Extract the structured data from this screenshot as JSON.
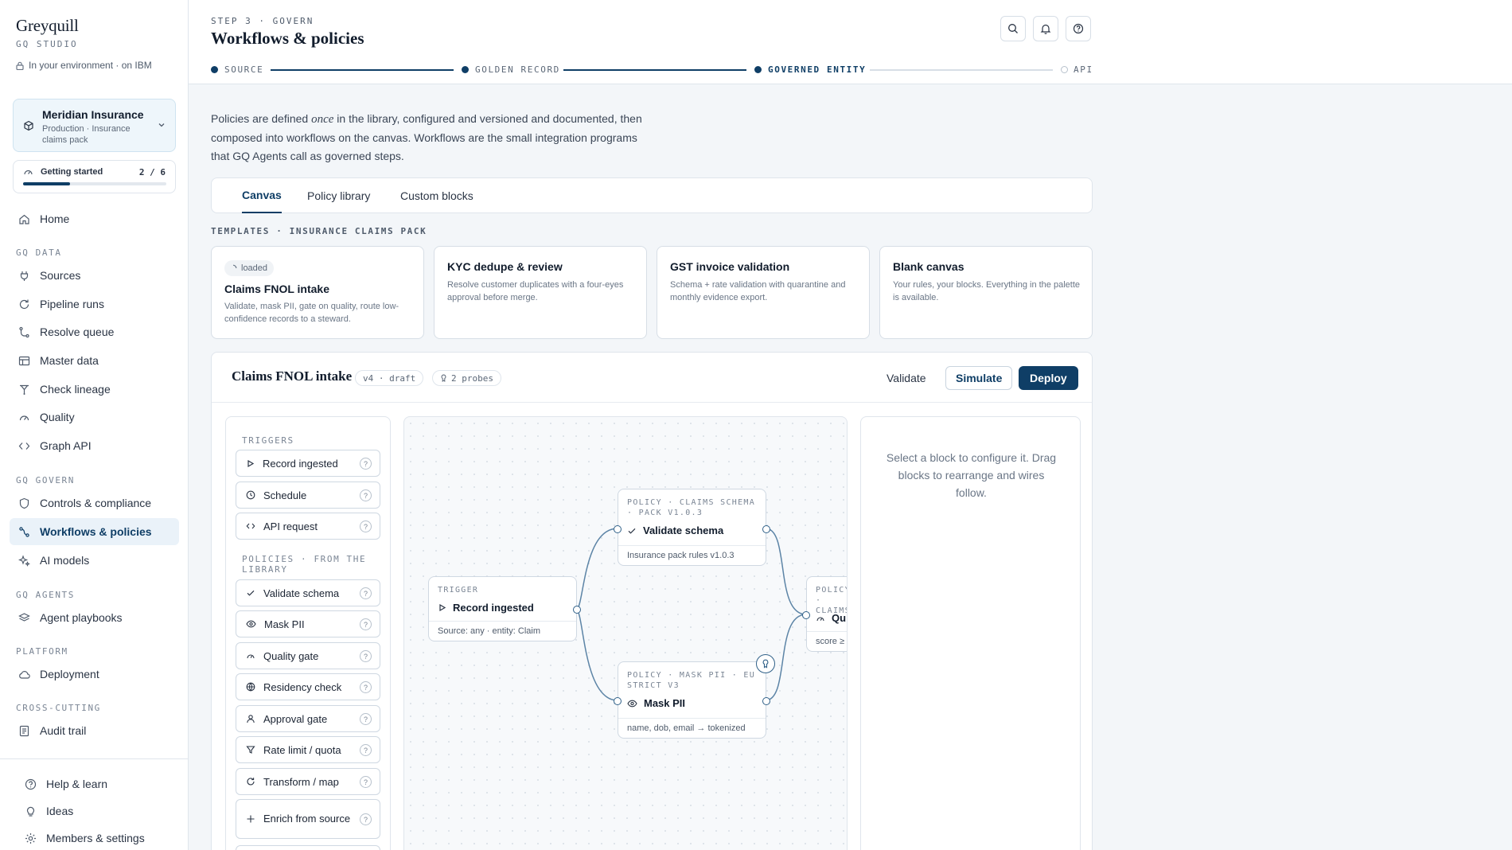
{
  "sidebar": {
    "brand": "Greyquill",
    "studio": "GQ STUDIO",
    "env": "In your environment · on IBM",
    "org": {
      "name": "Meridian Insurance",
      "sub": "Production · Insurance claims pack"
    },
    "getting_started": {
      "label": "Getting started",
      "count": "2 / 6",
      "progress": 0.33
    },
    "items": [
      {
        "label": "Home",
        "icon": "home-icon"
      },
      {
        "label": "Sources",
        "icon": "plug-icon"
      },
      {
        "label": "Pipeline runs",
        "icon": "refresh-icon"
      },
      {
        "label": "Resolve queue",
        "icon": "branch-icon"
      },
      {
        "label": "Master data",
        "icon": "table-icon"
      },
      {
        "label": "Check lineage",
        "icon": "lineage-icon"
      },
      {
        "label": "Quality",
        "icon": "gauge-icon"
      },
      {
        "label": "Graph API",
        "icon": "code-icon"
      },
      {
        "label": "Controls & compliance",
        "icon": "shield-icon"
      },
      {
        "label": "Workflows & policies",
        "icon": "workflow-icon"
      },
      {
        "label": "AI models",
        "icon": "sparkle-icon"
      },
      {
        "label": "Agent playbooks",
        "icon": "layers-icon"
      },
      {
        "label": "Deployment",
        "icon": "cloud-icon"
      },
      {
        "label": "Audit trail",
        "icon": "document-icon"
      }
    ],
    "sections": {
      "data": "GQ DATA",
      "govern": "GQ GOVERN",
      "agents": "GQ AGENTS",
      "platform": "PLATFORM",
      "cross": "CROSS-CUTTING"
    },
    "footer": [
      {
        "label": "Help & learn",
        "icon": "help-icon"
      },
      {
        "label": "Ideas",
        "icon": "bulb-icon"
      },
      {
        "label": "Members & settings",
        "icon": "gear-icon"
      }
    ]
  },
  "header": {
    "step": "STEP 3 · GOVERN",
    "title": "Workflows & policies",
    "stepper": [
      "SOURCE",
      "GOLDEN RECORD",
      "GOVERNED ENTITY",
      "API"
    ]
  },
  "intro": {
    "before": "Policies are defined ",
    "emph": "once",
    "after": " in the library, configured and versioned and documented, then composed into workflows on the canvas. Workflows are the small integration programs that GQ Agents call as governed steps."
  },
  "tabs": [
    "Canvas",
    "Policy library",
    "Custom blocks"
  ],
  "templates": {
    "label": "TEMPLATES · INSURANCE CLAIMS PACK",
    "loaded": "loaded",
    "items": [
      {
        "title": "Claims FNOL intake",
        "desc": "Validate, mask PII, gate on quality, route low-confidence records to a steward."
      },
      {
        "title": "KYC dedupe & review",
        "desc": "Resolve customer duplicates with a four-eyes approval before merge."
      },
      {
        "title": "GST invoice validation",
        "desc": "Schema + rate validation with quarantine and monthly evidence export."
      },
      {
        "title": "Blank canvas",
        "desc": "Your rules, your blocks. Everything in the palette is available."
      }
    ]
  },
  "workflow": {
    "title": "Claims FNOL intake",
    "version": "v4 · draft",
    "probes": "2 probes",
    "validate": "Validate",
    "simulate": "Simulate",
    "deploy": "Deploy",
    "palette": {
      "triggers_label": "TRIGGERS",
      "triggers": [
        "Record ingested",
        "Schedule",
        "API request"
      ],
      "policies_label": "POLICIES · FROM THE LIBRARY",
      "policies": [
        "Validate schema",
        "Mask PII",
        "Quality gate",
        "Residency check",
        "Approval gate",
        "Rate limit / quota",
        "Transform / map",
        "Enrich from source"
      ],
      "help": "?"
    },
    "nodes": {
      "trigger": {
        "kind": "TRIGGER",
        "title": "Record ingested",
        "detail": "Source: any · entity: Claim"
      },
      "schema": {
        "kind": "POLICY · CLAIMS SCHEMA · PACK V1.0.3",
        "title": "Validate schema",
        "detail": "Insurance pack rules v1.0.3"
      },
      "mask": {
        "kind": "POLICY · MASK PII · EU STRICT V3",
        "title": "Mask PII",
        "detail": "name, dob, email → tokenized"
      },
      "quality": {
        "kind": "POLICY · CLAIMS",
        "title": "Qu",
        "detail": "score ≥"
      }
    },
    "config_msg": "Select a block to configure it. Drag blocks to rearrange and wires follow."
  }
}
